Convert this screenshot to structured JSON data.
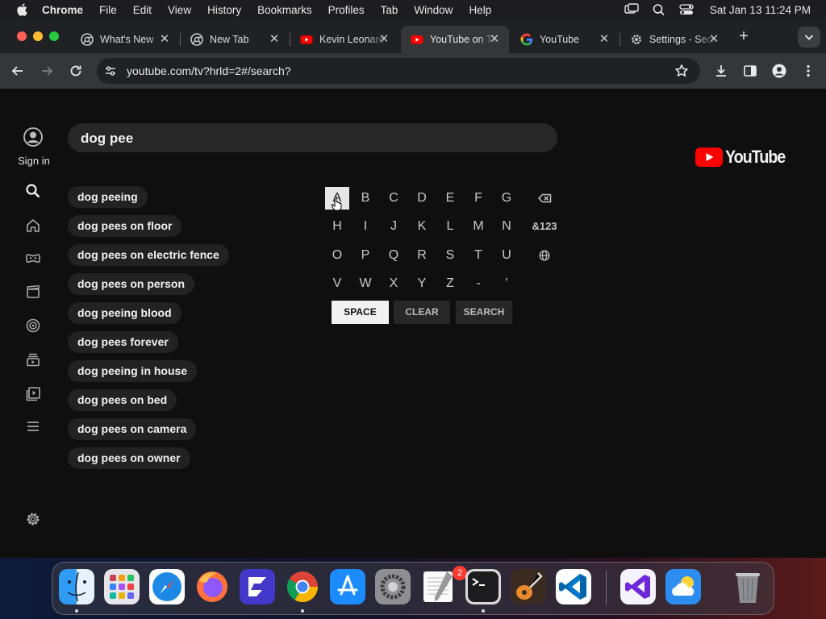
{
  "menubar": {
    "app_name": "Chrome",
    "items": [
      "File",
      "Edit",
      "View",
      "History",
      "Bookmarks",
      "Profiles",
      "Tab",
      "Window",
      "Help"
    ],
    "clock": "Sat Jan 13  11:24 PM"
  },
  "tabs": [
    {
      "title": "What's New",
      "icon": "chrome-icon"
    },
    {
      "title": "New Tab",
      "icon": "chrome-icon"
    },
    {
      "title": "Kevin Leonard",
      "icon": "youtube-icon"
    },
    {
      "title": "YouTube on TV",
      "icon": "youtube-icon",
      "active": true
    },
    {
      "title": "YouTube",
      "icon": "google-icon"
    },
    {
      "title": "Settings - Security",
      "icon": "gear-icon"
    }
  ],
  "address_bar": {
    "url": "youtube.com/tv?hrld=2#/search?"
  },
  "sidebar": {
    "sign_in_label": "Sign in"
  },
  "search": {
    "query": "dog pee"
  },
  "suggestions": [
    "dog peeing",
    "dog pees on floor",
    "dog pees on electric fence",
    "dog pees on person",
    "dog peeing blood",
    "dog pees forever",
    "dog peeing in house",
    "dog pees on bed",
    "dog pees on camera",
    "dog pees on owner"
  ],
  "keyboard": {
    "rows": [
      [
        "A",
        "B",
        "C",
        "D",
        "E",
        "F",
        "G"
      ],
      [
        "H",
        "I",
        "J",
        "K",
        "L",
        "M",
        "N"
      ],
      [
        "O",
        "P",
        "Q",
        "R",
        "S",
        "T",
        "U"
      ],
      [
        "V",
        "W",
        "X",
        "Y",
        "Z",
        "-",
        "'"
      ]
    ],
    "focused_key": "A",
    "symbols_label": "&123",
    "space_label": "SPACE",
    "clear_label": "CLEAR",
    "search_label": "SEARCH"
  },
  "logo": {
    "wordmark": "YouTube"
  },
  "dock": {
    "apps": [
      "finder-icon",
      "launchpad-icon",
      "safari-icon",
      "firefox-icon",
      "framer-icon",
      "chrome-icon",
      "app-store-icon",
      "system-settings-icon",
      "textedit-icon",
      "terminal-icon",
      "garageband-icon",
      "vscode-icon",
      "visual-studio-icon",
      "weather-icon",
      "trash-icon"
    ],
    "settings_badge": "2"
  },
  "colors": {
    "youtube_red": "#ff0000",
    "background": "#0f0f0f",
    "chip": "#222222"
  }
}
